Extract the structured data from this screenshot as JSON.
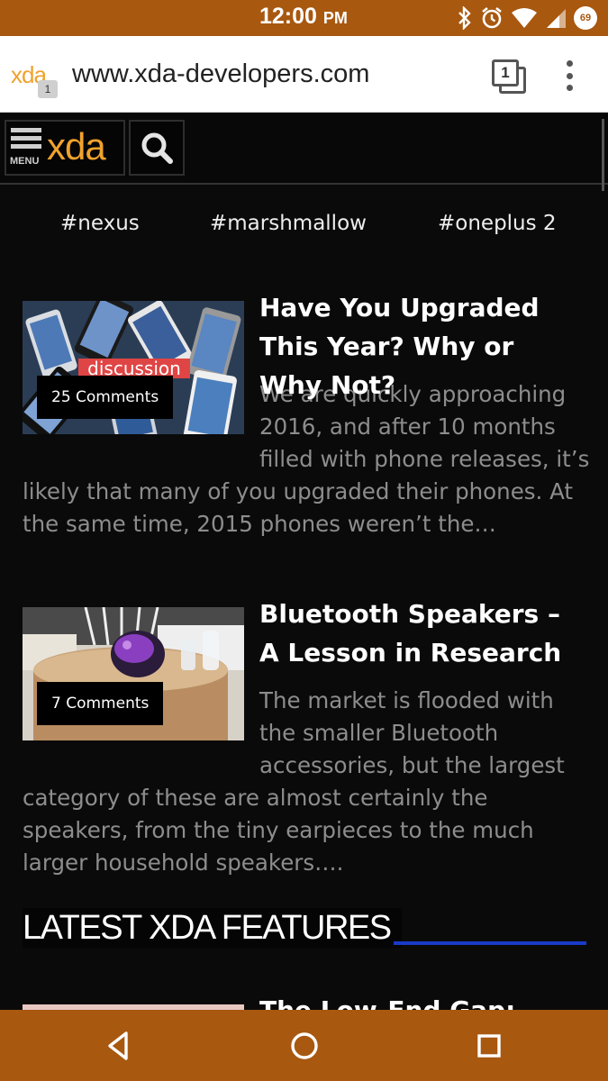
{
  "status_bar": {
    "time": "12:00",
    "ampm": "PM",
    "battery_level": "69",
    "background_color": "#a8580f"
  },
  "browser": {
    "favicon_text": "xda",
    "favicon_badge": "1",
    "url": "www.xda-developers.com",
    "tab_count": "1"
  },
  "site_header": {
    "menu_label": "MENU",
    "logo_text": "xda",
    "logo_color": "#f0a22c"
  },
  "tags": [
    "#nexus",
    "#marshmallow",
    "#oneplus 2"
  ],
  "articles": [
    {
      "title": "Have You Upgraded This Year? Why or Why Not?",
      "image_label": "discussion",
      "comments": "25 Comments",
      "excerpt": "We are quickly approaching 2016, and after 10 months filled with phone releases, it’s likely that many of you upgraded their phones. At the same time, 2015 phones weren’t the…"
    },
    {
      "title": "Bluetooth Speakers – A Lesson in Research",
      "comments": "7 Comments",
      "excerpt": "The market is flooded with the smaller Bluetooth accessories, but the largest category of these are almost certainly the speakers, from the tiny earpieces to the much larger household speakers…."
    }
  ],
  "section": {
    "heading": "LATEST XDA FEATURES",
    "accent_color": "#1a3ac8"
  },
  "next_article": {
    "title": "The Low-End Gap: Quick"
  },
  "nav_bar": {
    "background_color": "#a8580f"
  }
}
